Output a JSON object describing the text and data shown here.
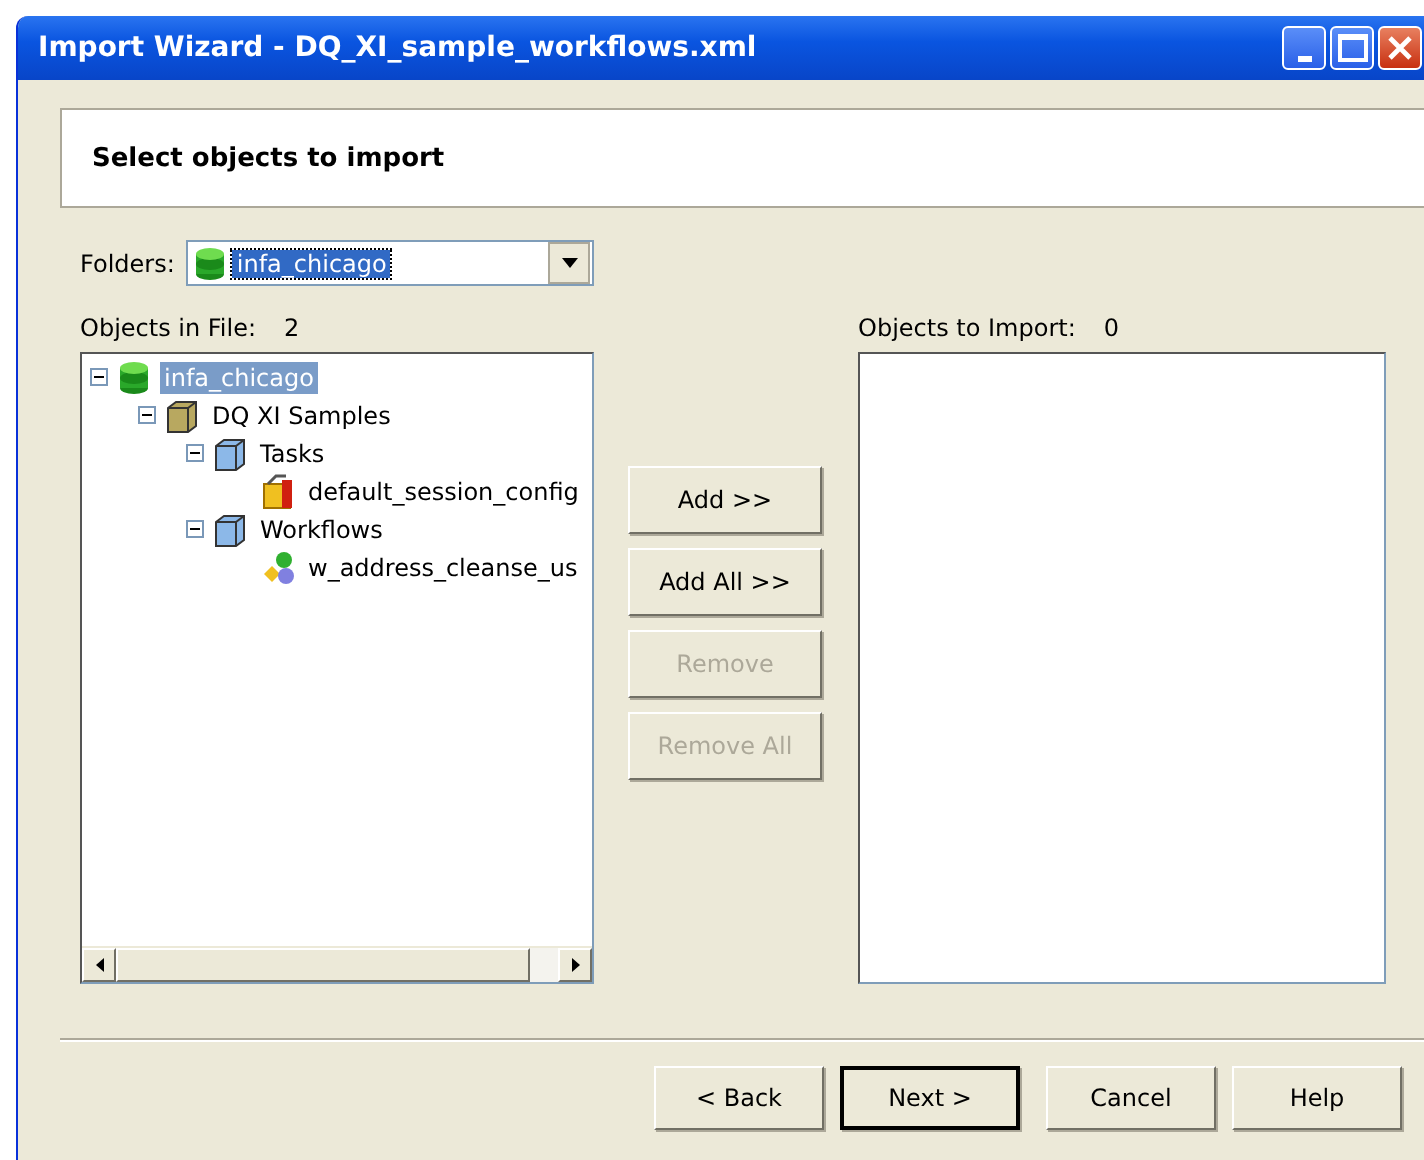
{
  "window": {
    "title": "Import Wizard - DQ_XI_sample_workflows.xml"
  },
  "header": {
    "title": "Select objects to import"
  },
  "folders": {
    "label": "Folders:",
    "value": "infa_chicago"
  },
  "objects_in_file": {
    "label": "Objects in File:",
    "count": "2"
  },
  "objects_to_import": {
    "label": "Objects to Import:",
    "count": "0"
  },
  "tree": [
    {
      "label": "infa_chicago",
      "kind": "repository",
      "selected": true,
      "expanded": true,
      "children": [
        {
          "label": "DQ XI Samples",
          "kind": "folder",
          "selected": false,
          "expanded": true,
          "children": [
            {
              "label": "Tasks",
              "kind": "group",
              "selected": false,
              "expanded": true,
              "children": [
                {
                  "label": "default_session_config",
                  "kind": "task",
                  "selected": false
                }
              ]
            },
            {
              "label": "Workflows",
              "kind": "group",
              "selected": false,
              "expanded": true,
              "children": [
                {
                  "label": "w_address_cleanse_us",
                  "kind": "workflow",
                  "selected": false
                }
              ]
            }
          ]
        }
      ]
    }
  ],
  "move_buttons": [
    {
      "label": "Add  >>",
      "disabled": false
    },
    {
      "label": "Add All >>",
      "disabled": false
    },
    {
      "label": "Remove",
      "disabled": true
    },
    {
      "label": "Remove All",
      "disabled": true
    }
  ],
  "footer_buttons": [
    {
      "label": "< Back",
      "default": false
    },
    {
      "label": "Next >",
      "default": true
    },
    {
      "label": "Cancel",
      "default": false
    },
    {
      "label": "Help",
      "default": false
    }
  ]
}
